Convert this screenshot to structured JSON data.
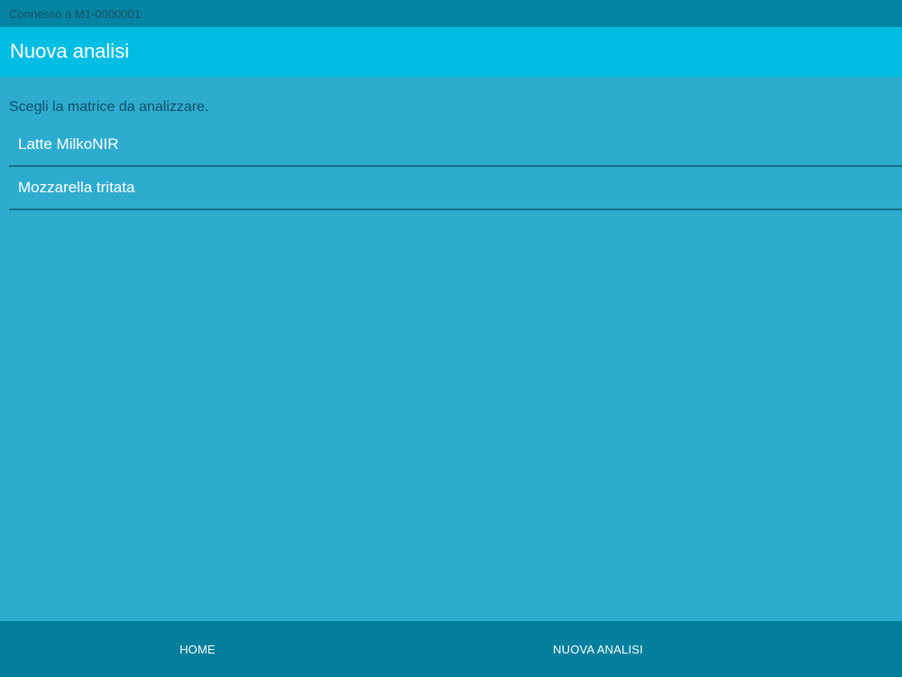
{
  "status_bar": {
    "text": "Connesso a M1-0000001"
  },
  "app_bar": {
    "title": "Nuova analisi"
  },
  "content": {
    "prompt": "Scegli la matrice da analizzare.",
    "items": [
      {
        "label": "Latte MilkoNIR"
      },
      {
        "label": "Mozzarella tritata"
      }
    ]
  },
  "bottom_nav": {
    "home_label": "HOME",
    "new_analysis_label": "NUOVA ANALISI"
  },
  "colors": {
    "status_bar": "#0384a3",
    "app_bar": "#00bde3",
    "background": "#2eaccf",
    "bottom_nav": "#017f9c",
    "divider": "#176f86"
  }
}
